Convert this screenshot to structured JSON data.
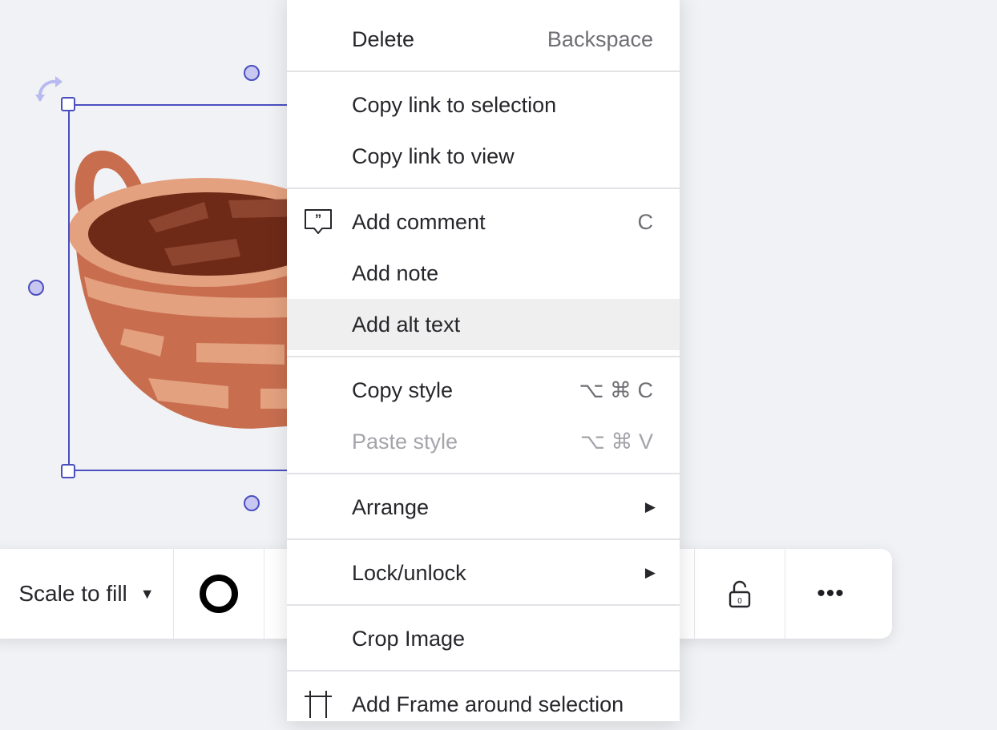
{
  "menu": {
    "items": [
      {
        "label": "Delete",
        "shortcut": "Backspace"
      },
      {
        "label": "Copy link to selection",
        "shortcut": ""
      },
      {
        "label": "Copy link to view",
        "shortcut": ""
      },
      {
        "label": "Add comment",
        "shortcut": "C",
        "icon": "comment-icon"
      },
      {
        "label": "Add note",
        "shortcut": ""
      },
      {
        "label": "Add alt text",
        "shortcut": "",
        "state": "hovered"
      },
      {
        "label": "Copy style",
        "shortcut": "⌥ ⌘ C"
      },
      {
        "label": "Paste style",
        "shortcut": "⌥ ⌘ V",
        "state": "disabled"
      },
      {
        "label": "Arrange",
        "submenu": true
      },
      {
        "label": "Lock/unlock",
        "submenu": true
      },
      {
        "label": "Crop Image",
        "shortcut": ""
      },
      {
        "label": "Add Frame around selection",
        "shortcut": "",
        "icon": "frame-icon"
      }
    ]
  },
  "toolbar": {
    "scale_label": "Scale to fill",
    "scale_caret": "▼",
    "stroke_color": "#000000",
    "lock_icon": "unlock-icon",
    "more_label": "•••"
  },
  "canvas": {
    "selection_color": "#4b4fbf",
    "handle_fill": "#c7c7f2",
    "image": "basket-image"
  }
}
